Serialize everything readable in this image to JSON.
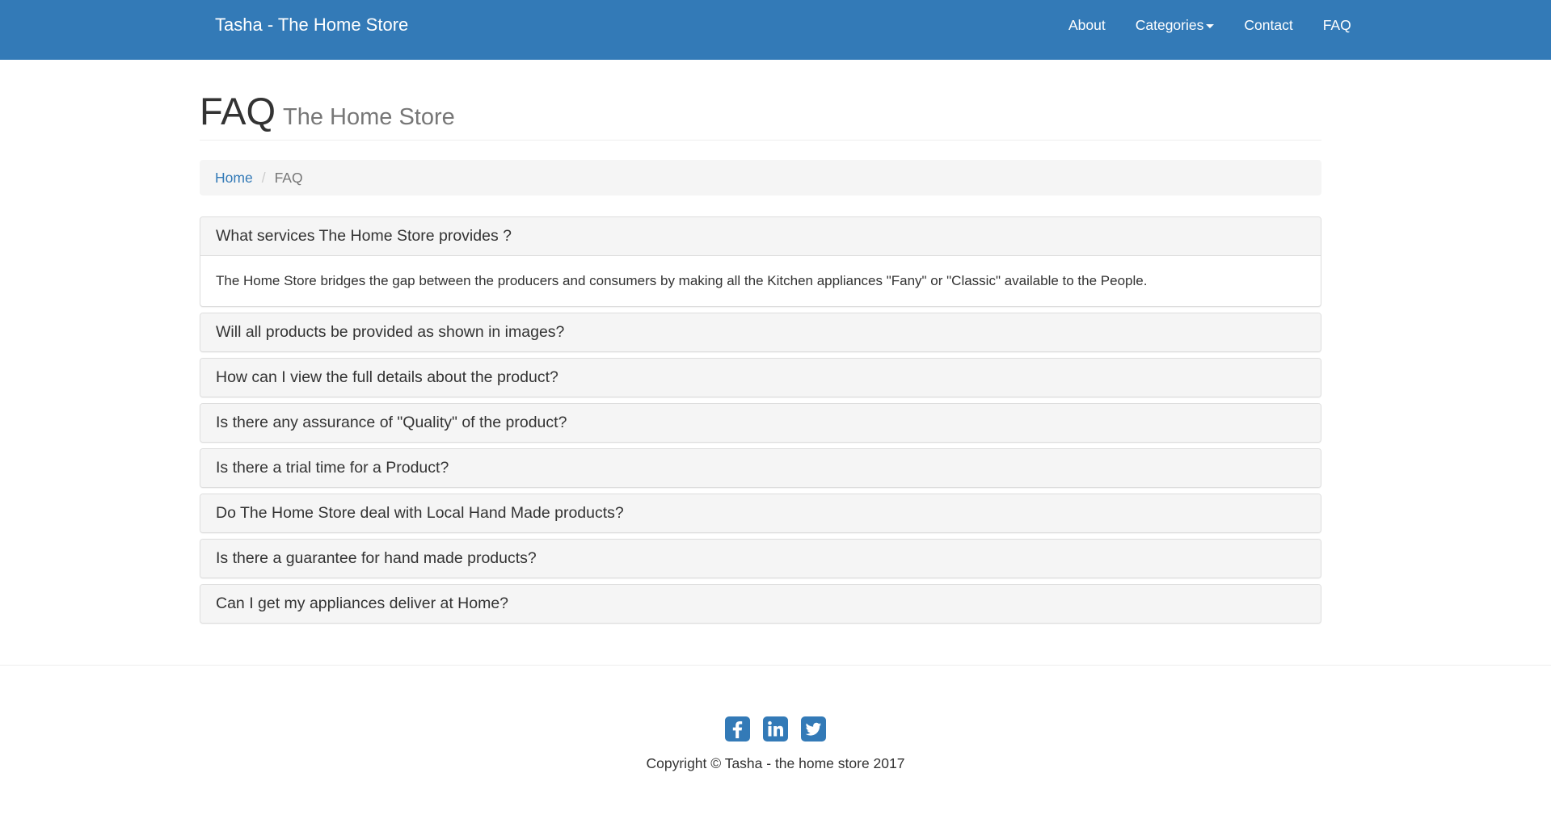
{
  "navbar": {
    "brand": "Tasha - The Home Store",
    "links": {
      "about": "About",
      "categories": "Categories",
      "contact": "Contact",
      "faq": "FAQ"
    }
  },
  "header": {
    "title": "FAQ",
    "subtitle": "The Home Store"
  },
  "breadcrumb": {
    "home": "Home",
    "separator": "/",
    "current": "FAQ"
  },
  "faq": {
    "items": [
      {
        "question": "What services The Home Store provides ?",
        "answer": "The Home Store bridges the gap between the producers and consumers by making all the Kitchen appliances \"Fany\" or \"Classic\" available to the People.",
        "expanded": true
      },
      {
        "question": "Will all products be provided as shown in images?",
        "expanded": false
      },
      {
        "question": "How can I view the full details about the product?",
        "expanded": false
      },
      {
        "question": "Is there any assurance of \"Quality\" of the product?",
        "expanded": false
      },
      {
        "question": "Is there a trial time for a Product?",
        "expanded": false
      },
      {
        "question": "Do The Home Store deal with Local Hand Made products?",
        "expanded": false
      },
      {
        "question": "Is there a guarantee for hand made products?",
        "expanded": false
      },
      {
        "question": "Can I get my appliances deliver at Home?",
        "expanded": false
      }
    ]
  },
  "footer": {
    "social_icons": [
      "facebook-icon",
      "linkedin-icon",
      "twitter-icon"
    ],
    "copyright": "Copyright © Tasha - the home store 2017"
  },
  "colors": {
    "primary": "#337ab7",
    "panel_heading_bg": "#f5f5f5",
    "border": "#dddddd",
    "subtitle": "#777777"
  }
}
